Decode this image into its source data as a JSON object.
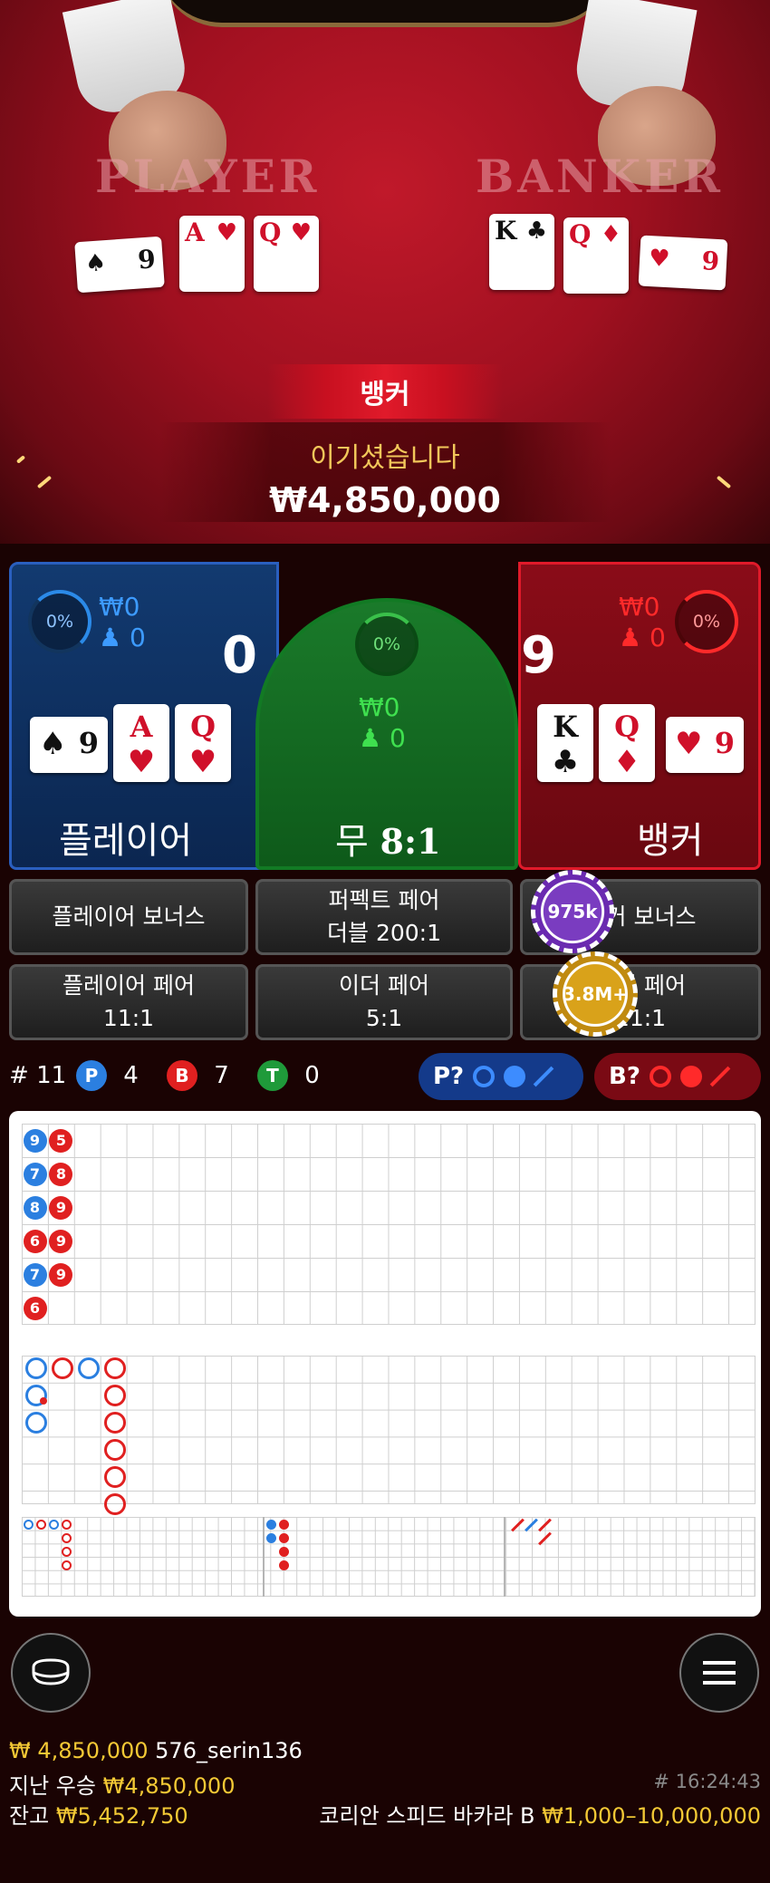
{
  "video": {
    "player_word": "PLAYER",
    "banker_word": "BANKER",
    "result_banner": "뱅커",
    "win_label": "이기셨습니다",
    "win_amount": "₩4,850,000",
    "player_cards": [
      {
        "rank": "9",
        "suit": "♠",
        "color": "blk"
      },
      {
        "rank": "A",
        "suit": "♥",
        "color": "red"
      },
      {
        "rank": "Q",
        "suit": "♥",
        "color": "red"
      }
    ],
    "banker_cards": [
      {
        "rank": "K",
        "suit": "♣",
        "color": "blk"
      },
      {
        "rank": "Q",
        "suit": "♦",
        "color": "red"
      },
      {
        "rank": "9",
        "suit": "♥",
        "color": "red"
      }
    ]
  },
  "player_panel": {
    "percent": "0%",
    "won": "₩0",
    "users": "0",
    "score": "0",
    "label": "플레이어",
    "cards": [
      {
        "rank": "9",
        "suit": "♠",
        "color": "blk"
      },
      {
        "rank": "A",
        "suit": "♥",
        "color": "red"
      },
      {
        "rank": "Q",
        "suit": "♥",
        "color": "red"
      }
    ]
  },
  "tie_panel": {
    "percent": "0%",
    "won": "₩0",
    "users": "0",
    "label_ko": "무",
    "payout": "8:1"
  },
  "banker_panel": {
    "percent": "0%",
    "won": "₩0",
    "users": "0",
    "score": "9",
    "label": "뱅커",
    "cards": [
      {
        "rank": "K",
        "suit": "♣",
        "color": "blk"
      },
      {
        "rank": "Q",
        "suit": "♦",
        "color": "red"
      },
      {
        "rank": "9",
        "suit": "♥",
        "color": "red"
      }
    ]
  },
  "side_bets": {
    "player_bonus": "플레이어 보너스",
    "perfect_pair": "퍼펙트 페어",
    "perfect_pair_payout": "더블 200:1",
    "banker_bonus": "뱅커 보너스",
    "player_pair": "플레이어 페어",
    "player_pair_payout": "11:1",
    "either_pair": "이더 페어",
    "either_pair_payout": "5:1",
    "banker_pair": "뱅커 페어",
    "banker_pair_payout": "11:1"
  },
  "chips": {
    "banker_bonus_chip": "975k",
    "banker_pair_chip": "3.8M+"
  },
  "stats": {
    "round_prefix": "#",
    "round": "11",
    "player_badge": "P",
    "player_count": "4",
    "banker_badge": "B",
    "banker_count": "7",
    "tie_badge": "T",
    "tie_count": "0",
    "player_predict": "P?",
    "banker_predict": "B?"
  },
  "bead_road": [
    {
      "col": 0,
      "row": 0,
      "v": "9",
      "side": "P"
    },
    {
      "col": 0,
      "row": 1,
      "v": "7",
      "side": "P"
    },
    {
      "col": 0,
      "row": 2,
      "v": "8",
      "side": "P"
    },
    {
      "col": 0,
      "row": 3,
      "v": "6",
      "side": "B"
    },
    {
      "col": 0,
      "row": 4,
      "v": "7",
      "side": "P"
    },
    {
      "col": 0,
      "row": 5,
      "v": "6",
      "side": "B"
    },
    {
      "col": 1,
      "row": 0,
      "v": "5",
      "side": "B"
    },
    {
      "col": 1,
      "row": 1,
      "v": "8",
      "side": "B"
    },
    {
      "col": 1,
      "row": 2,
      "v": "9",
      "side": "B"
    },
    {
      "col": 1,
      "row": 3,
      "v": "9",
      "side": "B"
    },
    {
      "col": 1,
      "row": 4,
      "v": "9",
      "side": "B"
    }
  ],
  "colors": {
    "player": "#2b7fe0",
    "banker": "#e02020",
    "tie": "#1f9a3a",
    "gold": "#f3c935",
    "chip_purple": "#7a3cc0",
    "chip_gold": "#d9a21a"
  },
  "footer": {
    "last_win_amount": "₩ 4,850,000",
    "last_win_user": "576_serin136",
    "prev_win_label": "지난 우승",
    "prev_win_amount": "₩4,850,000",
    "round_time": "# 16:24:43",
    "balance_label": "잔고",
    "balance_amount": "₩5,452,750",
    "table_name": "코리안 스피드 바카라 B",
    "limits": "₩1,000–10,000,000"
  }
}
